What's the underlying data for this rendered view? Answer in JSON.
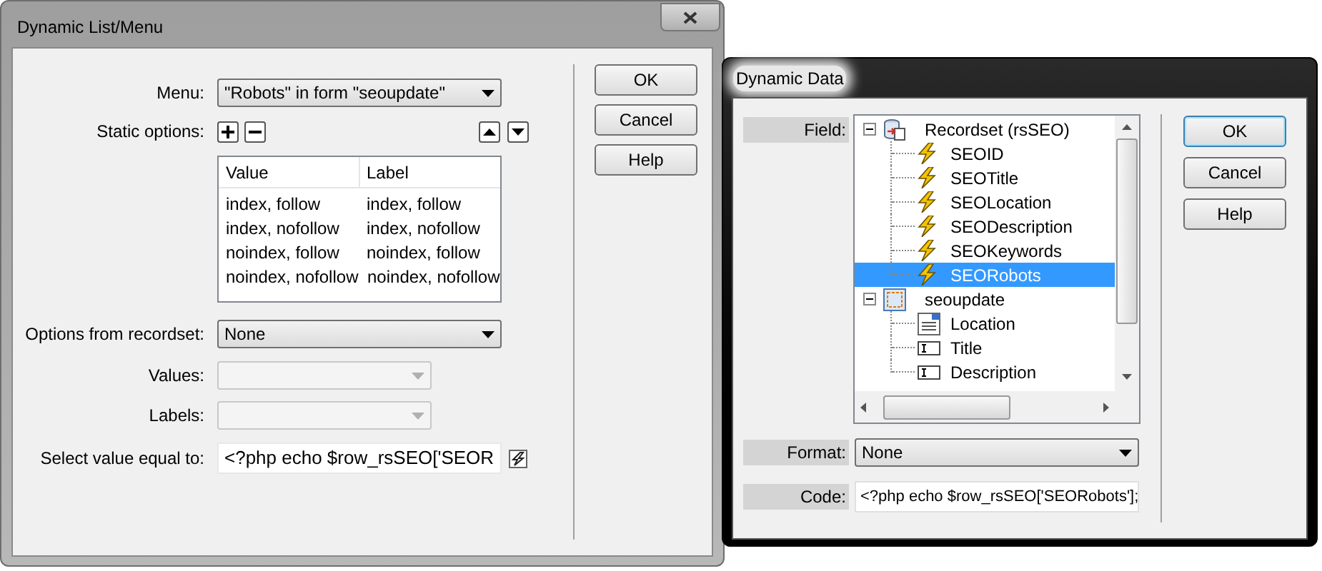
{
  "list_menu_dialog": {
    "title": "Dynamic List/Menu",
    "active": false,
    "menu": {
      "label": "Menu:",
      "value": "\"Robots\" in form \"seoupdate\""
    },
    "static_options": {
      "label": "Static options:",
      "columns": [
        "Value",
        "Label"
      ],
      "rows": [
        [
          "index, follow",
          "index, follow"
        ],
        [
          "index, nofollow",
          "index, nofollow"
        ],
        [
          "noindex, follow",
          "noindex, follow"
        ],
        [
          "noindex, nofollow",
          "noindex, nofollow"
        ]
      ]
    },
    "options_from_recordset": {
      "label": "Options from recordset:",
      "value": "None",
      "disabled": false
    },
    "values": {
      "label": "Values:",
      "disabled": true
    },
    "labels": {
      "label": "Labels:",
      "disabled": true
    },
    "select_value": {
      "label": "Select value equal to:",
      "value": "<?php echo $row_rsSEO['SEOR"
    },
    "buttons": [
      {
        "label": "OK",
        "default": false
      },
      {
        "label": "Cancel",
        "default": false
      },
      {
        "label": "Help",
        "default": false
      }
    ]
  },
  "dynamic_data_dialog": {
    "title": "Dynamic Data",
    "active": true,
    "field": {
      "label": "Field:",
      "tree": [
        {
          "label": "Recordset (rsSEO)",
          "kind": "recordset",
          "expanded": true,
          "selected": false,
          "children": [
            {
              "label": "SEOID",
              "kind": "column",
              "selected": false
            },
            {
              "label": "SEOTitle",
              "kind": "column",
              "selected": false
            },
            {
              "label": "SEOLocation",
              "kind": "column",
              "selected": false
            },
            {
              "label": "SEODescription",
              "kind": "column",
              "selected": false
            },
            {
              "label": "SEOKeywords",
              "kind": "column",
              "selected": false
            },
            {
              "label": "SEORobots",
              "kind": "column",
              "selected": true
            }
          ]
        },
        {
          "label": "seoupdate",
          "kind": "form",
          "expanded": true,
          "selected": false,
          "children": [
            {
              "label": "Location",
              "kind": "list",
              "selected": false
            },
            {
              "label": "Title",
              "kind": "textfield",
              "selected": false
            },
            {
              "label": "Description",
              "kind": "textfield",
              "selected": false
            }
          ]
        }
      ]
    },
    "format": {
      "label": "Format:",
      "value": "None"
    },
    "code": {
      "label": "Code:",
      "value": "<?php echo $row_rsSEO['SEORobots'];"
    },
    "buttons": [
      {
        "label": "OK",
        "default": true
      },
      {
        "label": "Cancel",
        "default": false
      },
      {
        "label": "Help",
        "default": false
      }
    ]
  }
}
